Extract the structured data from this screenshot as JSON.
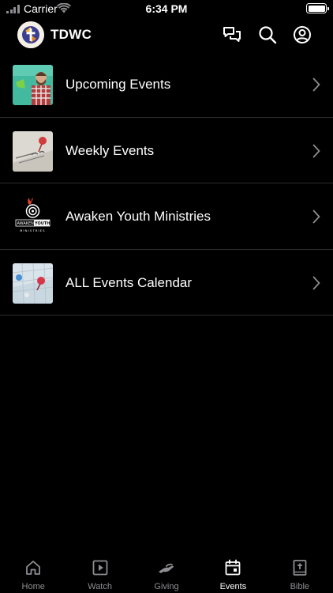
{
  "status_bar": {
    "carrier": "Carrier",
    "time": "6:34 PM"
  },
  "header": {
    "title": "TDWC",
    "icons": [
      "chat-icon",
      "search-icon",
      "account-icon"
    ]
  },
  "events": [
    {
      "label": "Upcoming Events",
      "thumbnail": "man-with-megaphone"
    },
    {
      "label": "Weekly Events",
      "thumbnail": "calendar-pushpin"
    },
    {
      "label": "Awaken Youth Ministries",
      "thumbnail": "awaken-youth-logo",
      "logo_text": [
        "AWAKEN",
        "YOUTH",
        "MINISTRIES"
      ]
    },
    {
      "label": "ALL Events Calendar",
      "thumbnail": "calendar-pins"
    }
  ],
  "tabs": [
    {
      "label": "Home",
      "icon": "home-icon",
      "active": false
    },
    {
      "label": "Watch",
      "icon": "play-icon",
      "active": false
    },
    {
      "label": "Giving",
      "icon": "giving-hand-icon",
      "active": false
    },
    {
      "label": "Events",
      "icon": "calendar-icon",
      "active": true
    },
    {
      "label": "Bible",
      "icon": "bible-icon",
      "active": false
    }
  ],
  "colors": {
    "background": "#000000",
    "separator": "#2c2c2e",
    "inactive_tab": "#8e8e93",
    "active_tab": "#ffffff"
  }
}
